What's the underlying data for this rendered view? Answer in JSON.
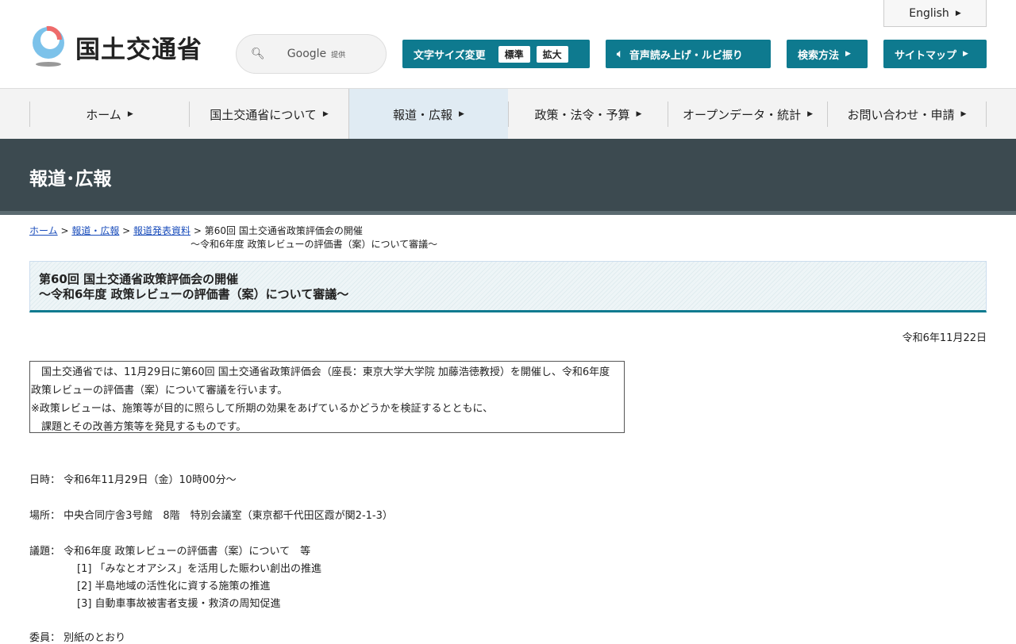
{
  "header": {
    "logo_text": "国土交通省",
    "search_google": "Google",
    "search_provided": "提供",
    "font_size_label": "文字サイズ変更",
    "font_standard": "標準",
    "font_large": "拡大",
    "speech_label": "音声読み上げ・ルビ振り",
    "search_method": "検索方法",
    "sitemap": "サイトマップ",
    "english": "English"
  },
  "nav": [
    "ホーム",
    "国土交通省について",
    "報道・広報",
    "政策・法令・予算",
    "オープンデータ・統計",
    "お問い合わせ・申請"
  ],
  "banner": "報道･広報",
  "breadcrumb": {
    "home": "ホーム",
    "press": "報道・広報",
    "releases": "報道発表資料",
    "current1": "第60回 国土交通省政策評価会の開催",
    "current2": "～令和6年度 政策レビューの評価書（案）について審議～"
  },
  "title": {
    "line1": "第60回 国土交通省政策評価会の開催",
    "line2": "～令和6年度 政策レビューの評価書（案）について審議～"
  },
  "date": "令和6年11月22日",
  "summary": [
    "　国土交通省では、11月29日に第60回 国土交通省政策評価会（座長：東京大学大学院 加藤浩徳教授）を開催し、令和6年度 政策レビューの評価書（案）について審議を行います。",
    "※政策レビューは、施策等が目的に照らして所期の効果をあげているかどうかを検証するとともに、",
    "　課題とその改善方策等を発見するものです。"
  ],
  "details": {
    "datetime": "日時： 令和6年11月29日（金）10時00分～",
    "place": "場所： 中央合同庁舎3号館　8階　特別会議室（東京都千代田区霞が関2-1-3）",
    "agenda": "議題： 令和6年度 政策レビューの評価書（案）について　等",
    "items": [
      "[1] 「みなとオアシス」を活用した賑わい創出の推進",
      "[2]  半島地域の活性化に資する施策の推進",
      "[3]  自動車事故被害者支援・救済の周知促進"
    ],
    "members": "委員： 別紙のとおり"
  }
}
